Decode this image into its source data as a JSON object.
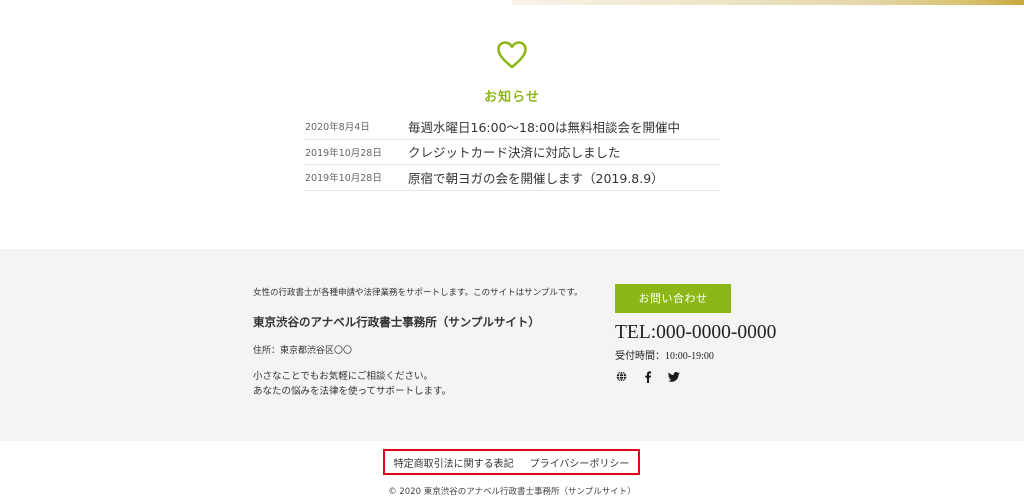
{
  "news": {
    "title": "お知らせ",
    "items": [
      {
        "date": "2020年8月4日",
        "text": "毎週水曜日16:00〜18:00は無料相談会を開催中"
      },
      {
        "date": "2019年10月28日",
        "text": "クレジットカード決済に対応しました"
      },
      {
        "date": "2019年10月28日",
        "text": "原宿で朝ヨガの会を開催します（2019.8.9）"
      }
    ],
    "accent_color": "#8db719"
  },
  "footer": {
    "description": "女性の行政書士が各種申請や法律業務をサポートします。このサイトはサンプルです。",
    "office_name": "東京渋谷のアナベル行政書士事務所（サンプルサイト）",
    "address": "住所：東京都渋谷区〇〇",
    "message_line1": "小さなことでもお気軽にご相談ください。",
    "message_line2": "あなたの悩みを法律を使ってサポートします。",
    "contact_button": "お問い合わせ",
    "tel": "TEL:000-0000-0000",
    "hours": "受付時間：10:00-19:00",
    "social_icons": [
      "globe-icon",
      "facebook-icon",
      "twitter-icon"
    ],
    "links": {
      "commerce_law": "特定商取引法に関する表記",
      "privacy": "プライバシーポリシー"
    },
    "highlight_color": "#e3001b",
    "copyright": "© 2020 東京渋谷のアナベル行政書士事務所（サンプルサイト）"
  }
}
